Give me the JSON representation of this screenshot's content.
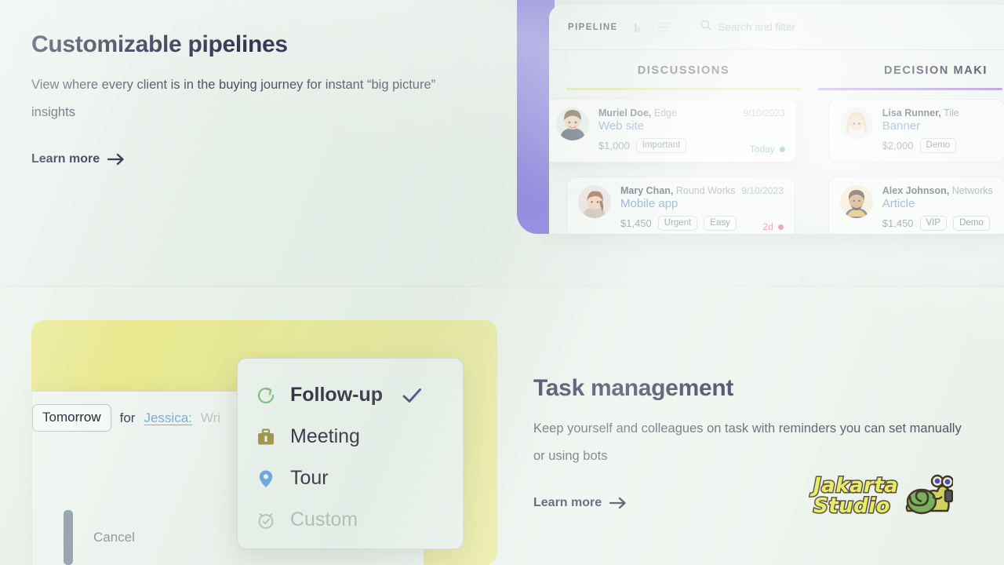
{
  "features": {
    "pipelines": {
      "title": "Customizable pipelines",
      "description": "View where every client is in the buying journey for instant “big picture” insights",
      "learn_more": "Learn more",
      "arrow_icon": "arrow-right-icon"
    },
    "tasks": {
      "title": "Task management",
      "description": "Keep yourself and colleagues on task with reminders you can set manually or using bots",
      "learn_more": "Learn more",
      "arrow_icon": "arrow-right-icon"
    }
  },
  "pipeline_app": {
    "wordmark": "PIPELINE",
    "chart_icon": "bar-chart-icon",
    "list_icon": "list-view-icon",
    "search_icon": "search-icon",
    "search_placeholder": "Search and filter",
    "columns": [
      {
        "label": "DISCUSSIONS",
        "underline_color": "#d9dc84",
        "cards": [
          {
            "person": "Muriel Doe,",
            "company": "Edge",
            "date": "9/10/2023",
            "deal": "Web site",
            "amount": "$1,000",
            "tags": [
              "Important"
            ],
            "status": "Today",
            "status_color": "#4fb38a",
            "avatar": "avatar-muriel-doe"
          },
          {
            "person": "Mary Chan,",
            "company": "Round Works",
            "date": "9/10/2023",
            "deal": "Mobile app",
            "amount": "$1,450",
            "tags": [
              "Urgent",
              "Easy"
            ],
            "status": "2d",
            "status_color": "#e06a8d",
            "avatar": "avatar-mary-chan"
          }
        ]
      },
      {
        "label": "DECISION MAKI",
        "underline_color": "#a983d9",
        "cards": [
          {
            "person": "Lisa Runner,",
            "company": "Tile",
            "date": "",
            "deal": "Banner",
            "amount": "$2,000",
            "tags": [
              "Demo"
            ],
            "status": "",
            "status_color": "",
            "avatar": "avatar-lisa-runner"
          },
          {
            "person": "Alex Johnson,",
            "company": "Networks",
            "date": "",
            "deal": "Article",
            "amount": "$1,450",
            "tags": [
              "VIP",
              "Demo"
            ],
            "status": "",
            "status_color": "",
            "avatar": "avatar-alex-johnson"
          }
        ]
      }
    ]
  },
  "task_editor": {
    "date_chip": "Tomorrow",
    "for_label": "for",
    "assignee": "Jessica:",
    "task_text": "Wri",
    "cancel_label": "Cancel"
  },
  "task_type_menu": {
    "items": [
      {
        "label": "Follow-up",
        "icon": "refresh-circle-icon",
        "icon_color": "#76b97f",
        "selected": true,
        "disabled": false
      },
      {
        "label": "Meeting",
        "icon": "briefcase-icon",
        "icon_color": "#998a39",
        "selected": false,
        "disabled": false
      },
      {
        "label": "Tour",
        "icon": "map-pin-icon",
        "icon_color": "#5c9fe0",
        "selected": false,
        "disabled": false
      },
      {
        "label": "Custom",
        "icon": "alarm-clock-icon",
        "icon_color": "#b4beb8",
        "selected": false,
        "disabled": true
      }
    ],
    "check_icon": "checkmark-icon",
    "check_color": "#2a2f6b"
  },
  "logo": {
    "line1": "Jakarta",
    "line2": "Studio",
    "mascot_icon": "snail-mascot-icon"
  },
  "colors": {
    "background": "#e9f1ea",
    "purple_panel": "#7b6ade",
    "yellow_card": "#e8e88f",
    "heading": "#121334",
    "deal_link": "#5b8fc9"
  }
}
